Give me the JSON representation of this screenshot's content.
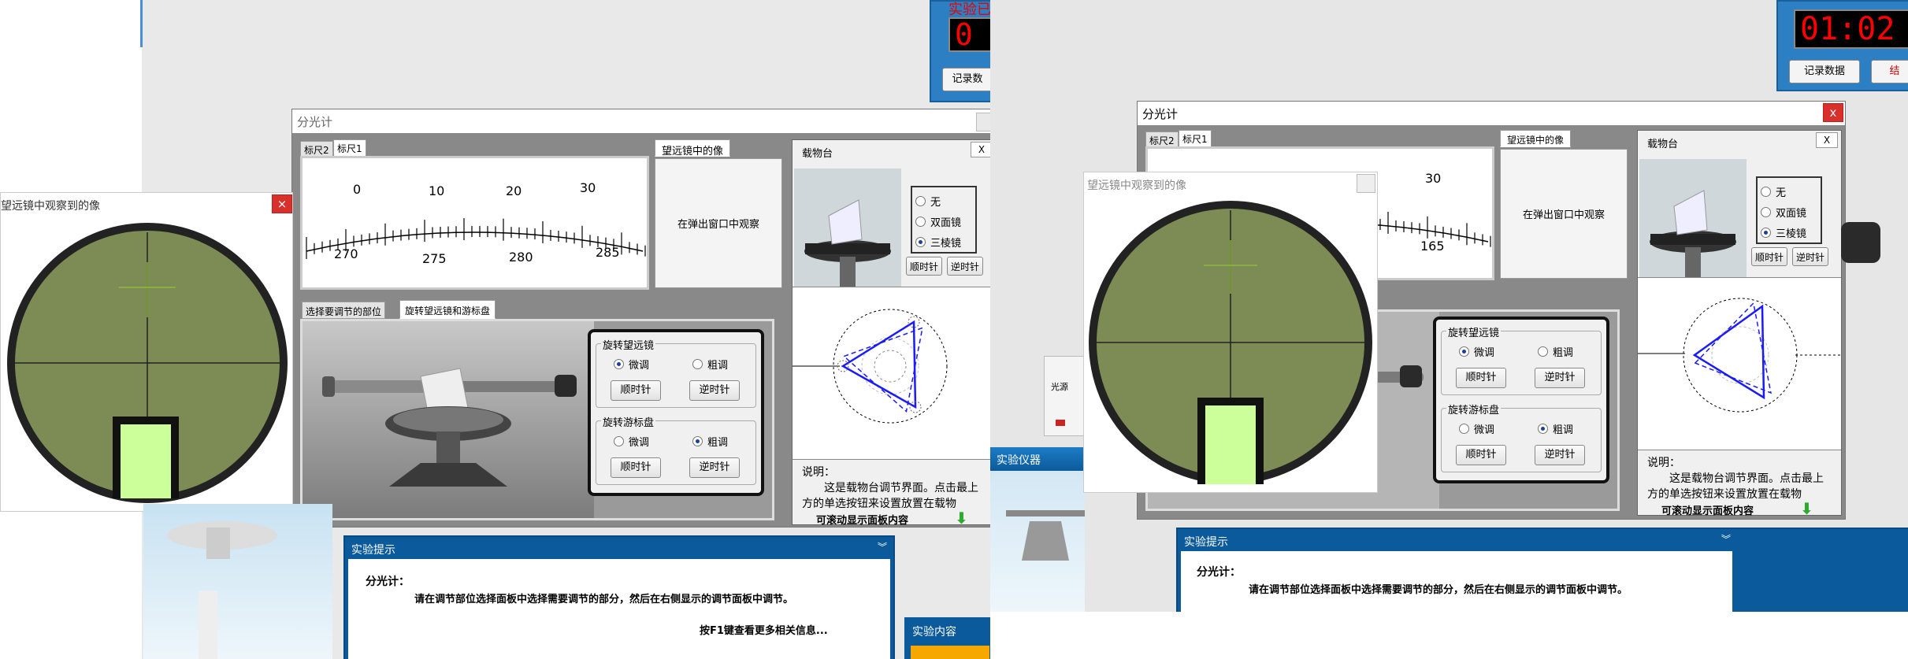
{
  "left_screen": {
    "timer_title": "实验已",
    "timer_value": "0",
    "record_btn": "记录数",
    "spectrometer": {
      "title": "分光计",
      "tabs": [
        "标尺2",
        "标尺1"
      ],
      "scale_top": [
        "0",
        "10",
        "20",
        "30"
      ],
      "scale_bottom": [
        "270",
        "275",
        "280",
        "285"
      ],
      "image_tab": "望远镜中的像",
      "image_text": "在弹出窗口中观察",
      "adjust_tabs": [
        "选择要调节的部位",
        "旋转望远镜和游标盘"
      ],
      "telescope_group": "旋转望远镜",
      "vernier_group": "旋转游标盘",
      "fine": "微调",
      "coarse": "粗调",
      "cw": "顺时针",
      "ccw": "逆时针"
    },
    "stage": {
      "title": "载物台",
      "close": "X",
      "options": [
        "无",
        "双面镜",
        "三棱镜"
      ],
      "selected": "三棱镜",
      "cw": "顺时针",
      "ccw": "逆时针",
      "note_title": "说明：",
      "note_text": "这是载物台调节界面。点击最上方的单选按钮来设置放置在载物",
      "scroll_label": "可滚动显示面板内容"
    },
    "scope_popup": {
      "title": "望远镜中观察到的像",
      "close": "×"
    },
    "hint": {
      "title": "实验提示",
      "subject": "分光计：",
      "line1": "请在调节部位选择面板中选择需要调节的部分，然后在右侧显示的调节面板中调节。",
      "line2": "按F1键查看更多相关信息..."
    },
    "content_tab": "实验内容"
  },
  "right_screen": {
    "timer_value": "01:02",
    "record_btn": "记录数据",
    "end_btn": "结",
    "spectrometer": {
      "title": "分光计",
      "close": "x",
      "tabs": [
        "标尺2",
        "标尺1"
      ],
      "scale_top": [
        "30"
      ],
      "scale_bottom": [
        "165"
      ],
      "image_tab": "望远镜中的像",
      "image_text": "在弹出窗口中观察",
      "telescope_group": "旋转望远镜",
      "vernier_group": "旋转游标盘",
      "fine": "微调",
      "coarse": "粗调",
      "cw": "顺时针",
      "ccw": "逆时针"
    },
    "stage": {
      "title": "载物台",
      "close": "X",
      "options": [
        "无",
        "双面镜",
        "三棱镜"
      ],
      "selected": "三棱镜",
      "cw": "顺时针",
      "ccw": "逆时针",
      "note_title": "说明：",
      "note_text": "这是载物台调节界面。点击最上方的单选按钮来设置放置在载物",
      "scroll_label": "可滚动显示面板内容"
    },
    "scope_popup": {
      "title": "望远镜中观察到的像"
    },
    "light_label": "光源",
    "instrument_tab": "实验仪器",
    "hint": {
      "title": "实验提示",
      "subject": "分光计：",
      "line1": "请在调节部位选择面板中选择需要调节的部分，然后在右侧显示的调节面板中调节。"
    }
  },
  "colors": {
    "scope_field": "#7d8c55",
    "slit": "#ccff99",
    "stage_line": "#1a1aff",
    "window_blue": "#0b5a9b"
  }
}
